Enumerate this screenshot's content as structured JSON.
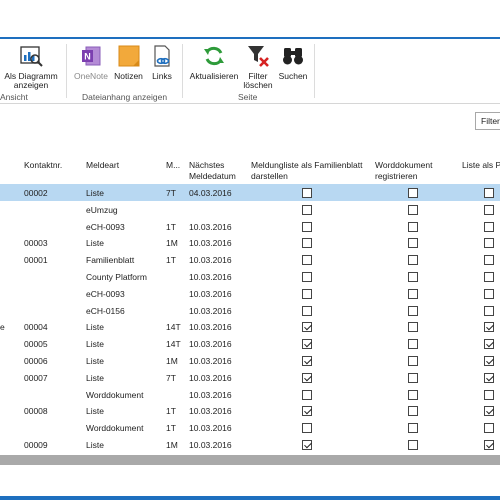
{
  "ribbon": {
    "buttons": {
      "diagram": "Als Diagramm\nanzeigen",
      "onenote": "OneNote",
      "notizen": "Notizen",
      "links": "Links",
      "aktualisieren": "Aktualisieren",
      "filter_loeschen": "Filter\nlöschen",
      "suchen": "Suchen"
    },
    "groups": {
      "ansicht": "Ansicht",
      "dateianhang": "Dateianhang anzeigen",
      "seite": "Seite"
    }
  },
  "filter": {
    "label": "Filter"
  },
  "table": {
    "headers": {
      "kontaktnr": "Kontaktnr.",
      "meldeart": "Meldeart",
      "m": "M...",
      "naechstes": "Nächstes\nMeldedatum",
      "meldungliste": "Meldungliste als Familienblatt\ndarstellen",
      "worddokument": "Worddokument\nregistrieren",
      "liste_als": "Liste als P"
    },
    "rows": [
      {
        "prefix": "",
        "kontakt": "00002",
        "meldeart": "Liste",
        "m": "7T",
        "datum": "04.03.2016",
        "c1": false,
        "c2": false,
        "c3": false,
        "selected": true
      },
      {
        "prefix": "",
        "kontakt": "",
        "meldeart": "eUmzug",
        "m": "",
        "datum": "",
        "c1": false,
        "c2": false,
        "c3": false,
        "selected": false
      },
      {
        "prefix": "",
        "kontakt": "",
        "meldeart": "eCH-0093",
        "m": "1T",
        "datum": "10.03.2016",
        "c1": false,
        "c2": false,
        "c3": false,
        "selected": false
      },
      {
        "prefix": "",
        "kontakt": "00003",
        "meldeart": "Liste",
        "m": "1M",
        "datum": "10.03.2016",
        "c1": false,
        "c2": false,
        "c3": false,
        "selected": false
      },
      {
        "prefix": "",
        "kontakt": "00001",
        "meldeart": "Familienblatt",
        "m": "1T",
        "datum": "10.03.2016",
        "c1": false,
        "c2": false,
        "c3": false,
        "selected": false
      },
      {
        "prefix": "",
        "kontakt": "",
        "meldeart": "County Platform",
        "m": "",
        "datum": "10.03.2016",
        "c1": false,
        "c2": false,
        "c3": false,
        "selected": false
      },
      {
        "prefix": "",
        "kontakt": "",
        "meldeart": "eCH-0093",
        "m": "",
        "datum": "10.03.2016",
        "c1": false,
        "c2": false,
        "c3": false,
        "selected": false
      },
      {
        "prefix": "",
        "kontakt": "",
        "meldeart": "eCH-0156",
        "m": "",
        "datum": "10.03.2016",
        "c1": false,
        "c2": false,
        "c3": false,
        "selected": false
      },
      {
        "prefix": "e",
        "kontakt": "00004",
        "meldeart": "Liste",
        "m": "14T",
        "datum": "10.03.2016",
        "c1": true,
        "c2": false,
        "c3": true,
        "selected": false
      },
      {
        "prefix": "",
        "kontakt": "00005",
        "meldeart": "Liste",
        "m": "14T",
        "datum": "10.03.2016",
        "c1": true,
        "c2": false,
        "c3": true,
        "selected": false
      },
      {
        "prefix": "",
        "kontakt": "00006",
        "meldeart": "Liste",
        "m": "1M",
        "datum": "10.03.2016",
        "c1": true,
        "c2": false,
        "c3": true,
        "selected": false
      },
      {
        "prefix": "",
        "kontakt": "00007",
        "meldeart": "Liste",
        "m": "7T",
        "datum": "10.03.2016",
        "c1": true,
        "c2": false,
        "c3": true,
        "selected": false
      },
      {
        "prefix": "",
        "kontakt": "",
        "meldeart": "Worddokument",
        "m": "",
        "datum": "10.03.2016",
        "c1": false,
        "c2": false,
        "c3": false,
        "selected": false
      },
      {
        "prefix": "",
        "kontakt": "00008",
        "meldeart": "Liste",
        "m": "1T",
        "datum": "10.03.2016",
        "c1": true,
        "c2": false,
        "c3": true,
        "selected": false
      },
      {
        "prefix": "",
        "kontakt": "",
        "meldeart": "Worddokument",
        "m": "1T",
        "datum": "10.03.2016",
        "c1": false,
        "c2": false,
        "c3": false,
        "selected": false
      },
      {
        "prefix": "",
        "kontakt": "00009",
        "meldeart": "Liste",
        "m": "1M",
        "datum": "10.03.2016",
        "c1": true,
        "c2": false,
        "c3": true,
        "selected": false
      }
    ]
  },
  "colors": {
    "accent": "#1e6fbf",
    "selected_row": "#b8d8f2",
    "scrollbar": "#a9a9a9"
  }
}
